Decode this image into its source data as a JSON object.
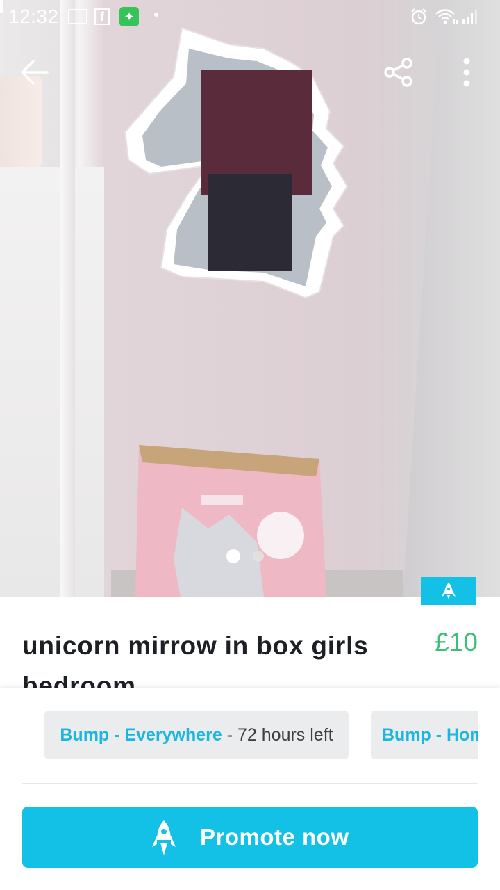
{
  "status_bar": {
    "time": "12:32"
  },
  "listing": {
    "title": "unicorn mirrow in box girls bedroom",
    "price": "£10",
    "photo_count": 2,
    "photo_current": 1
  },
  "bump_options": [
    {
      "accent": "Bump - Everywhere",
      "rest": " - 72 hours left"
    },
    {
      "accent": "Bump - Hom",
      "rest": ""
    }
  ],
  "promote_button": {
    "label": "Promote now"
  },
  "colors": {
    "accent": "#13c1e6",
    "price": "#3fbf76",
    "chip_bg": "#eaeced"
  }
}
